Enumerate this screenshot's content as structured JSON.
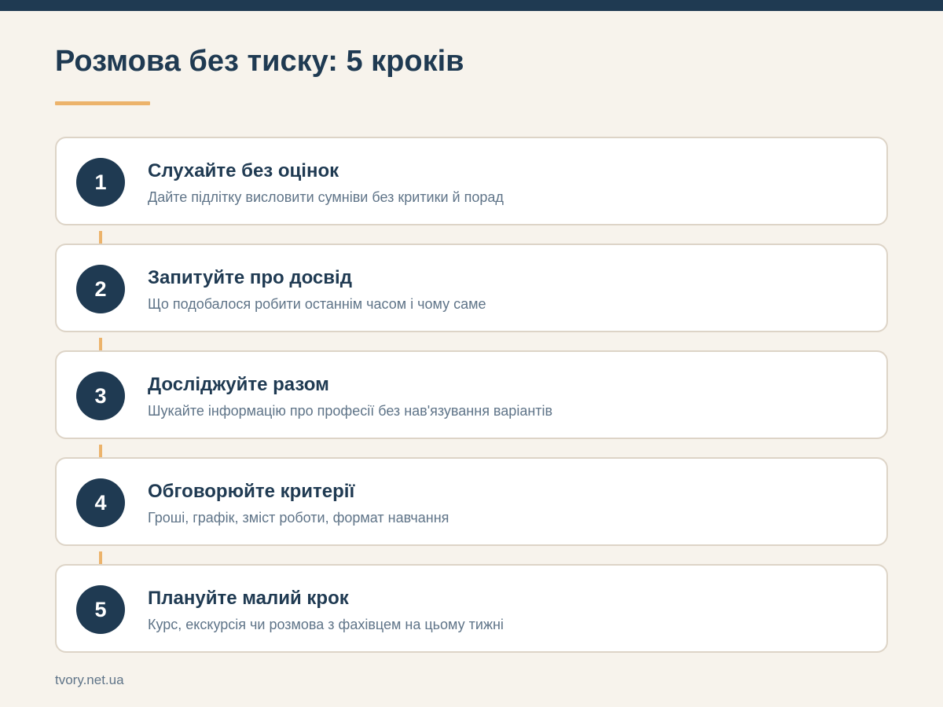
{
  "header": {
    "title": "Розмова без тиску: 5 кроків"
  },
  "steps": [
    {
      "number": "1",
      "title": "Слухайте без оцінок",
      "description": "Дайте підлітку висловити сумніви без критики й порад"
    },
    {
      "number": "2",
      "title": "Запитуйте про досвід",
      "description": "Що подобалося робити останнім часом і чому саме"
    },
    {
      "number": "3",
      "title": "Досліджуйте разом",
      "description": "Шукайте інформацію про професії без нав'язування варіантів"
    },
    {
      "number": "4",
      "title": "Обговорюйте критерії",
      "description": "Гроші, графік, зміст роботи, формат навчання"
    },
    {
      "number": "5",
      "title": "Плануйте малий крок",
      "description": "Курс, екскурсія чи розмова з фахівцем на цьому тижні"
    }
  ],
  "footer": {
    "source": "tvory.net.ua"
  },
  "colors": {
    "background": "#f7f3ec",
    "primary_navy": "#1f3a52",
    "accent_orange": "#ecb36b",
    "card_border": "#ddd4c7",
    "muted_text": "#5f7488"
  }
}
